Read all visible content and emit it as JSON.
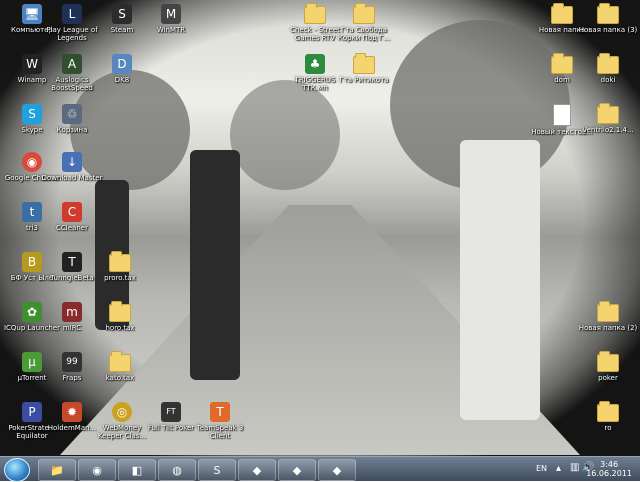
{
  "desktop": {
    "icons": [
      {
        "label": "Компьютер",
        "symbol": "🖥",
        "color": "#4d82bf"
      },
      {
        "label": "Play League of Legends",
        "symbol": "L",
        "color": "#1e3155"
      },
      {
        "label": "Steam",
        "symbol": "S",
        "color": "#2c2c2c"
      },
      {
        "label": "WinMTR",
        "symbol": "M",
        "color": "#444444"
      },
      {
        "label": "Check - Street Games RTV",
        "symbol": "",
        "color": ""
      },
      {
        "label": "Гта Свобода Корки Под Г...",
        "symbol": "",
        "color": ""
      },
      {
        "label": "Новая папка",
        "symbol": "",
        "color": ""
      },
      {
        "label": "Новая папка (3)",
        "symbol": "",
        "color": ""
      },
      {
        "label": "Winamp",
        "symbol": "W",
        "color": "#222222"
      },
      {
        "label": "Auslogics BoostSpeed",
        "symbol": "A",
        "color": "#2f4f2f"
      },
      {
        "label": "DK8",
        "symbol": "D",
        "color": "#5a86c0"
      },
      {
        "label": "TRIGGERUS ТТК.мп",
        "symbol": "♣",
        "color": "#2e8b3d"
      },
      {
        "label": "Гта Ритикота",
        "symbol": "",
        "color": ""
      },
      {
        "label": "dom",
        "symbol": "",
        "color": ""
      },
      {
        "label": "doki",
        "symbol": "",
        "color": ""
      },
      {
        "label": "Skype",
        "symbol": "S",
        "color": "#1ea1dc"
      },
      {
        "label": "Корзина",
        "symbol": "♲",
        "color": "#5a6b80"
      },
      {
        "label": "Новый текстов...",
        "symbol": "",
        "color": ""
      },
      {
        "label": "Ventrilo2.1.4...",
        "symbol": "",
        "color": ""
      },
      {
        "label": "Google Chrome",
        "symbol": "◉",
        "color": "#d94a38"
      },
      {
        "label": "Download Master",
        "symbol": "↓",
        "color": "#4b6fb5"
      },
      {
        "label": "tri3",
        "symbol": "t",
        "color": "#3b6ea5"
      },
      {
        "label": "CCleaner",
        "symbol": "C",
        "color": "#d03b2b"
      },
      {
        "label": "БФ Уст Ыле",
        "symbol": "B",
        "color": "#b59a1f"
      },
      {
        "label": "TunngleBeta",
        "symbol": "T",
        "color": "#222222"
      },
      {
        "label": "proro.tax",
        "symbol": "",
        "color": ""
      },
      {
        "label": "ICQup Launcher",
        "symbol": "✿",
        "color": "#3f8f2f"
      },
      {
        "label": "mIRC",
        "symbol": "m",
        "color": "#8a2b2b"
      },
      {
        "label": "horo.tax",
        "symbol": "",
        "color": ""
      },
      {
        "label": "Новая папка (2)",
        "symbol": "",
        "color": ""
      },
      {
        "label": "µTorrent",
        "symbol": "µ",
        "color": "#4a9a3a"
      },
      {
        "label": "Fraps",
        "symbol": "99",
        "color": "#333333"
      },
      {
        "label": "kato.tax",
        "symbol": "",
        "color": ""
      },
      {
        "label": "poker",
        "symbol": "",
        "color": ""
      },
      {
        "label": "PokerStrate... Equilator",
        "symbol": "P",
        "color": "#3a4da0"
      },
      {
        "label": "HoldemMan...",
        "symbol": "✹",
        "color": "#c44a2a"
      },
      {
        "label": "WebMoney Keeper Clas...",
        "symbol": "◎",
        "color": "#c9a320"
      },
      {
        "label": "Full Tilt Poker",
        "symbol": "FT",
        "color": "#333333"
      },
      {
        "label": "TeamSpeak 3 Client",
        "symbol": "T",
        "color": "#e06a2a"
      },
      {
        "label": "ro",
        "symbol": "",
        "color": ""
      }
    ]
  },
  "taskbar": {
    "buttons": [
      {
        "name": "explorer",
        "symbol": "📁"
      },
      {
        "name": "chrome",
        "symbol": "◉"
      },
      {
        "name": "app-3",
        "symbol": "◧"
      },
      {
        "name": "app-4",
        "symbol": "◍"
      },
      {
        "name": "skype",
        "symbol": "S"
      },
      {
        "name": "game-1",
        "symbol": "◆"
      },
      {
        "name": "game-2",
        "symbol": "◆"
      },
      {
        "name": "game-3",
        "symbol": "◆"
      }
    ],
    "tray": {
      "lang": "EN",
      "time": "3:46",
      "date": "16.06.2011"
    }
  }
}
